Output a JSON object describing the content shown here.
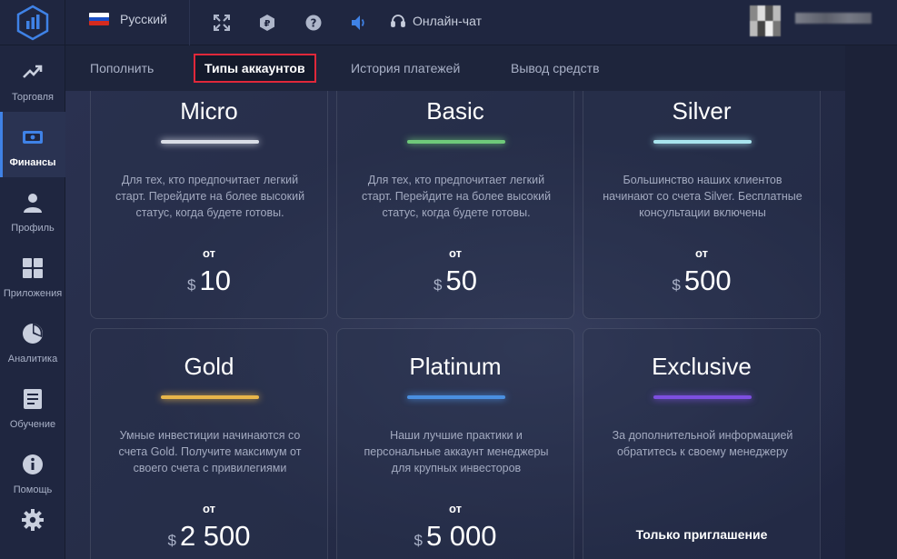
{
  "topbar": {
    "language": "Русский",
    "chat_label": "Онлайн-чат",
    "flag_colors": [
      "#ffffff",
      "#1b4fc4",
      "#d52b1e"
    ]
  },
  "sidebar": {
    "items": [
      {
        "label": "Торговля",
        "icon": "trending-up-icon"
      },
      {
        "label": "Финансы",
        "icon": "money-icon",
        "active": true
      },
      {
        "label": "Профиль",
        "icon": "user-icon"
      },
      {
        "label": "Приложения",
        "icon": "apps-grid-icon"
      },
      {
        "label": "Аналитика",
        "icon": "pie-chart-icon"
      },
      {
        "label": "Обучение",
        "icon": "document-icon"
      },
      {
        "label": "Помощь",
        "icon": "info-icon"
      },
      {
        "label": "",
        "icon": "gear-icon"
      }
    ]
  },
  "tabs": [
    {
      "label": "Пополнить"
    },
    {
      "label": "Типы аккаунтов",
      "active": true
    },
    {
      "label": "История платежей"
    },
    {
      "label": "Вывод средств"
    }
  ],
  "cards": [
    {
      "name": "Micro",
      "accent": "#d9dde6",
      "desc": "Для тех, кто предпочитает легкий старт. Перейдите на более высокий статус, когда будете готовы.",
      "from": "от",
      "currency": "$",
      "amount": "10"
    },
    {
      "name": "Basic",
      "accent": "#6fc97a",
      "desc": "Для тех, кто предпочитает легкий старт. Перейдите на более высокий статус, когда будете готовы.",
      "from": "от",
      "currency": "$",
      "amount": "50"
    },
    {
      "name": "Silver",
      "accent": "#a8e4ee",
      "desc": "Большинство наших клиентов начинают со счета Silver. Бесплатные консультации включены",
      "from": "от",
      "currency": "$",
      "amount": "500"
    },
    {
      "name": "Gold",
      "accent": "#e8b54a",
      "desc": "Умные инвестиции начинаются со счета Gold. Получите максимум от своего счета с привилегиями",
      "from": "от",
      "currency": "$",
      "amount": "2 500"
    },
    {
      "name": "Platinum",
      "accent": "#4a8fe0",
      "desc": "Наши лучшие практики и персональные аккаунт менеджеры для крупных инвесторов",
      "from": "от",
      "currency": "$",
      "amount": "5 000"
    },
    {
      "name": "Exclusive",
      "accent": "#7d4fe0",
      "desc": "За дополнительной информацией обратитесь к своему менеджеру",
      "invite": "Только приглашение"
    }
  ]
}
